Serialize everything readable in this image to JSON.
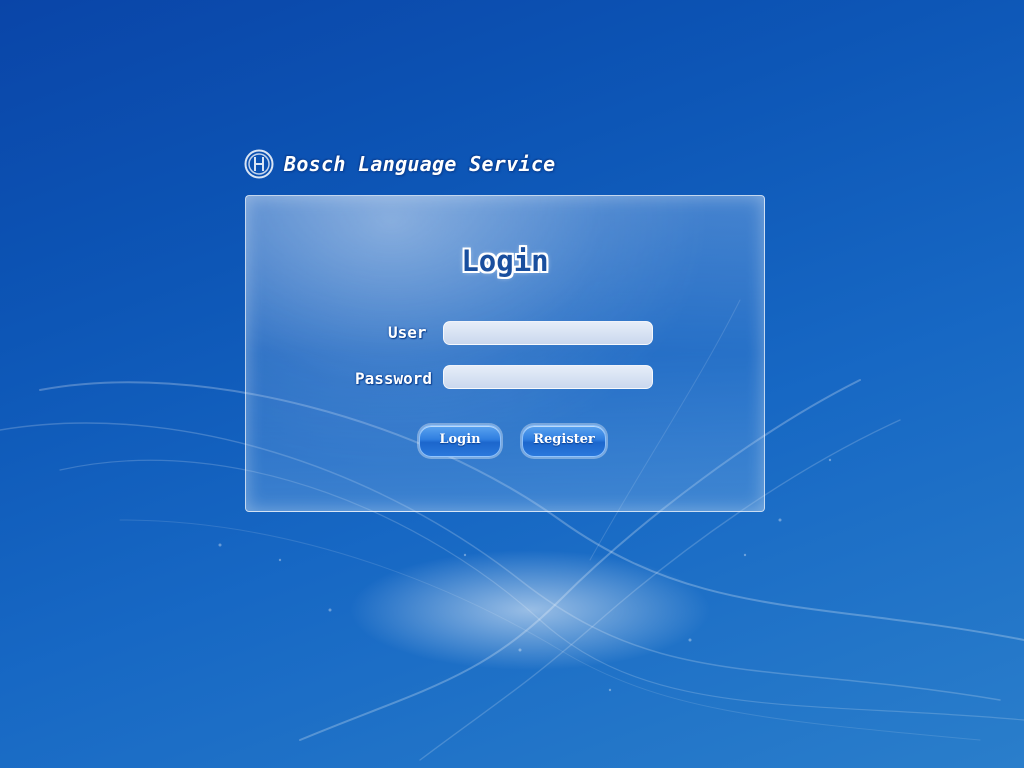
{
  "brand": {
    "name": "Bosch Language Service",
    "logo_icon": "bosch-logo-icon"
  },
  "login_panel": {
    "title": "Login",
    "user_label": "User",
    "user_value": "",
    "password_label": "Password",
    "password_value": "",
    "login_button": "Login",
    "register_button": "Register"
  },
  "colors": {
    "background_top": "#0a45a8",
    "background_bottom": "#2a7ecb",
    "button": "#2f7ee0",
    "title_text": "#1a4f9e"
  }
}
